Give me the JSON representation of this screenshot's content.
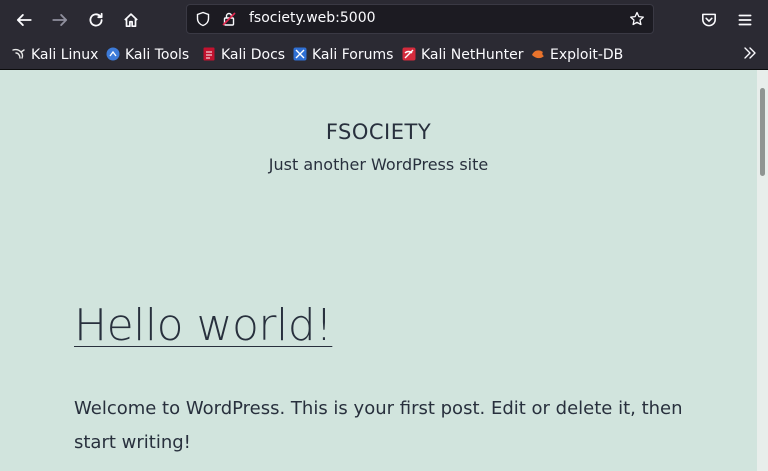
{
  "browser": {
    "url": "fsociety.web:5000",
    "bookmarks": [
      {
        "label": "Kali Linux",
        "icon": "kali-dragon-icon"
      },
      {
        "label": "Kali Tools",
        "icon": "kali-tools-icon"
      },
      {
        "label": "Kali Docs",
        "icon": "kali-docs-icon"
      },
      {
        "label": "Kali Forums",
        "icon": "kali-forums-icon"
      },
      {
        "label": "Kali NetHunter",
        "icon": "kali-nethunter-icon"
      },
      {
        "label": "Exploit-DB",
        "icon": "exploit-db-icon"
      }
    ]
  },
  "site": {
    "title": "FSOCIETY",
    "description": "Just another WordPress site"
  },
  "post": {
    "title": "Hello world!",
    "body": "Welcome to WordPress. This is your first post. Edit or delete it, then start writing!"
  },
  "colors": {
    "page_background": "#d1e4dd",
    "text": "#28303d",
    "toolbar": "#2b2a33"
  }
}
